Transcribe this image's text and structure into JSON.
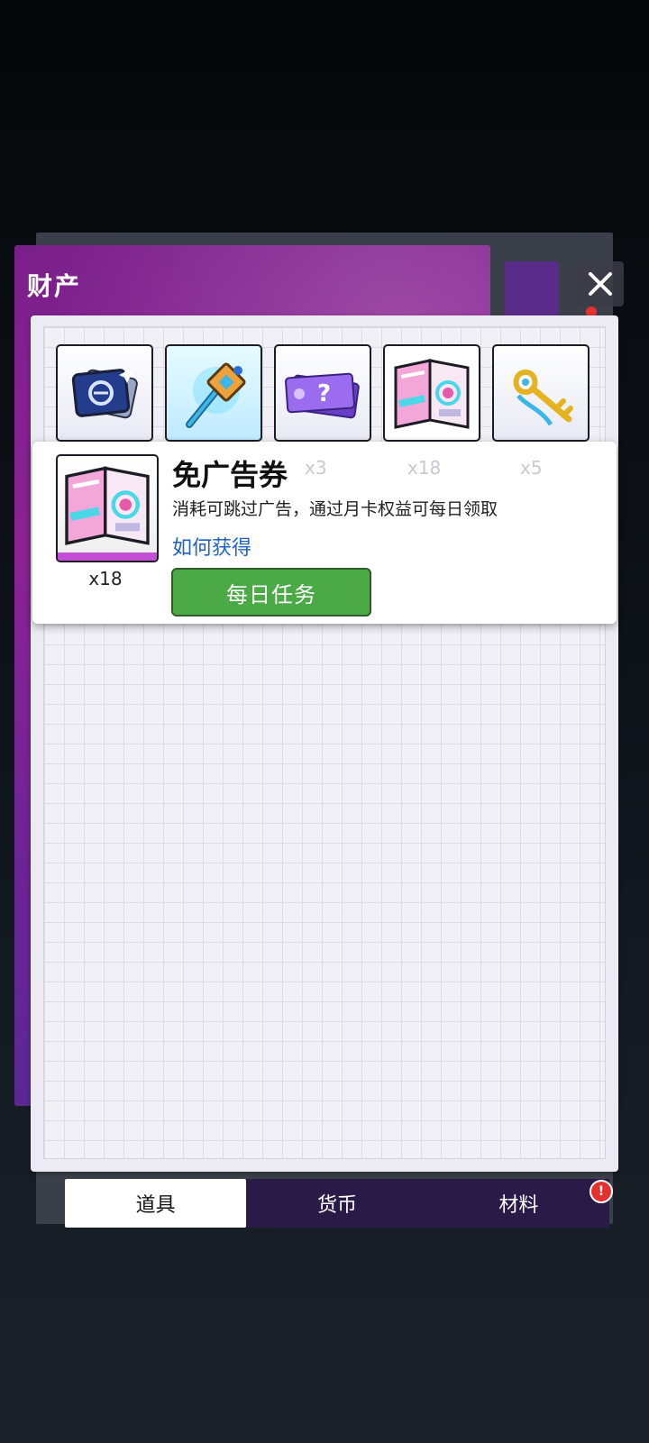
{
  "header": {
    "title": "财产"
  },
  "items": [
    {
      "name": "blue-card-item",
      "count": "",
      "bar_color": "#cfe6f4"
    },
    {
      "name": "key-staff-item",
      "count": "",
      "bar_color": "#ecd4ee"
    },
    {
      "name": "mystery-ticket-item",
      "count": "x3",
      "bar_color": "#ecd4ee"
    },
    {
      "name": "ad-skip-ticket-item",
      "count": "x18",
      "bar_color": "#f1d0ec"
    },
    {
      "name": "golden-key-item",
      "count": "x5",
      "bar_color": "#cfe6f4"
    }
  ],
  "detail": {
    "title": "免广告券",
    "description": "消耗可跳过广告，通过月卡权益可每日领取",
    "how_to_get": "如何获得",
    "action_button": "每日任务",
    "count": "x18"
  },
  "tabs": [
    {
      "label": "道具",
      "active": true
    },
    {
      "label": "货币",
      "active": false
    },
    {
      "label": "材料",
      "active": false
    }
  ],
  "badge": "!"
}
